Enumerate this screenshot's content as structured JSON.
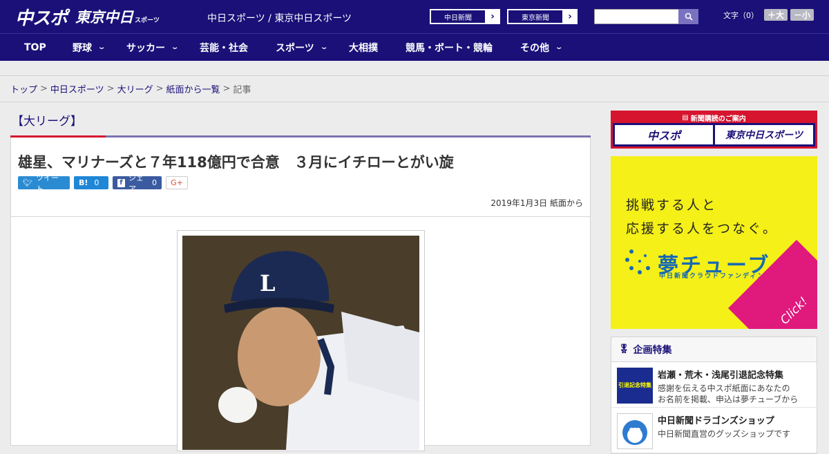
{
  "header": {
    "logo_main": "中スポ",
    "logo_tokyo": "東京中日",
    "logo_tokyo_suffix": "スポーツ",
    "site_title": "中日スポーツ / 東京中日スポーツ",
    "paper_links": [
      {
        "label": "中日新聞",
        "arrow": "›"
      },
      {
        "label": "東京新聞",
        "arrow": "›"
      }
    ],
    "search_placeholder": "",
    "font_label": "文字（0）",
    "font_up": "＋大",
    "font_down": "－小"
  },
  "nav": {
    "items": [
      {
        "label": "TOP",
        "dropdown": false
      },
      {
        "label": "野球",
        "dropdown": true
      },
      {
        "label": "サッカー",
        "dropdown": true
      },
      {
        "label": "芸能・社会",
        "dropdown": false
      },
      {
        "label": "スポーツ",
        "dropdown": true
      },
      {
        "label": "大相撲",
        "dropdown": false
      },
      {
        "label": "競馬・ボート・競輪",
        "dropdown": false
      },
      {
        "label": "その他",
        "dropdown": true
      }
    ],
    "chevron": "⌄"
  },
  "breadcrumb": {
    "items": [
      "トップ",
      "中日スポーツ",
      "大リーグ",
      "紙面から一覧",
      "記事"
    ],
    "separator": ">"
  },
  "article": {
    "category": "【大リーグ】",
    "headline": "雄星、マリナーズと７年118億円で合意　３月にイチローとがい旋",
    "share": {
      "tweet": "ツイート",
      "hatena": "B!",
      "hatena_count": "0",
      "facebook": "シェア",
      "facebook_count": "0",
      "gplus": "G+"
    },
    "date": "2019年1月3日 紙面から"
  },
  "sidebar": {
    "subscribe_title": "新聞購読のご案内",
    "subscribe_links": [
      "中スポ",
      "東京中日スポーツ"
    ],
    "ad": {
      "line1": "挑戦する人と",
      "line2": "応援する人をつなぐ。",
      "logo": "夢チューブ",
      "sub": "中日新聞クラウドファンディング",
      "click": "Click!"
    },
    "feature_title": "企画特集",
    "features": [
      {
        "title": "岩瀬・荒木・浅尾引退記念特集",
        "desc1": "感謝を伝える中スポ紙面にあなたの",
        "desc2": "お名前を掲載、申込は夢チューブから",
        "thumb": "引退記念特集"
      },
      {
        "title": "中日新聞ドラゴンズショップ",
        "desc1": "中日新聞直営のグッズショップです",
        "desc2": "",
        "thumb": ""
      }
    ]
  },
  "colors": {
    "brand": "#1a1078",
    "accent": "#d6142e",
    "ad_yellow": "#f4f018",
    "ad_pink": "#e0197d"
  }
}
